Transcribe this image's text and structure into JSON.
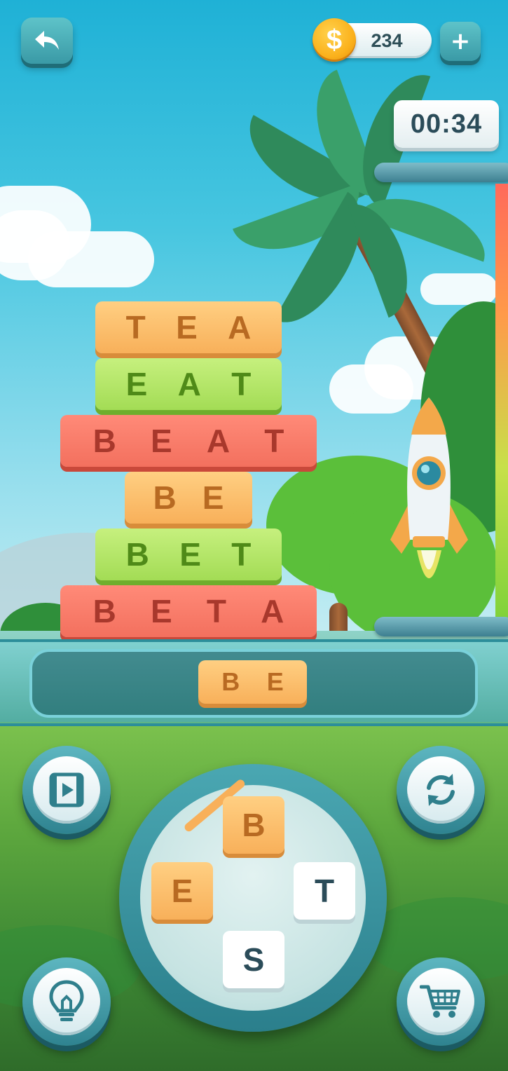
{
  "header": {
    "back_icon": "undo-arrow-icon",
    "coins": "234",
    "coin_symbol": "$",
    "add_coins_label": "+"
  },
  "timer": {
    "value": "00:34"
  },
  "progress": {
    "level_fraction": 0.5
  },
  "tower": {
    "words": [
      {
        "letters": [
          "T",
          "E",
          "A"
        ],
        "color": "orange"
      },
      {
        "letters": [
          "E",
          "A",
          "T"
        ],
        "color": "green"
      },
      {
        "letters": [
          "B",
          "E",
          "A",
          "T"
        ],
        "color": "red"
      },
      {
        "letters": [
          "B",
          "E"
        ],
        "color": "orange"
      },
      {
        "letters": [
          "B",
          "E",
          "T"
        ],
        "color": "green"
      },
      {
        "letters": [
          "B",
          "E",
          "T",
          "A"
        ],
        "color": "red"
      }
    ]
  },
  "current_word": {
    "letters": [
      "B",
      "E"
    ]
  },
  "wheel": {
    "letters": [
      {
        "char": "B",
        "selected": true
      },
      {
        "char": "E",
        "selected": true
      },
      {
        "char": "T",
        "selected": false
      },
      {
        "char": "S",
        "selected": false
      }
    ]
  },
  "buttons": {
    "video": "video-reward-icon",
    "shuffle": "shuffle-icon",
    "hint": "lightbulb-icon",
    "shop": "shopping-cart-icon"
  },
  "colors": {
    "orange": "#f8b05a",
    "green": "#a3dc55",
    "red": "#f3705e",
    "teal": "#3a9aa6"
  }
}
